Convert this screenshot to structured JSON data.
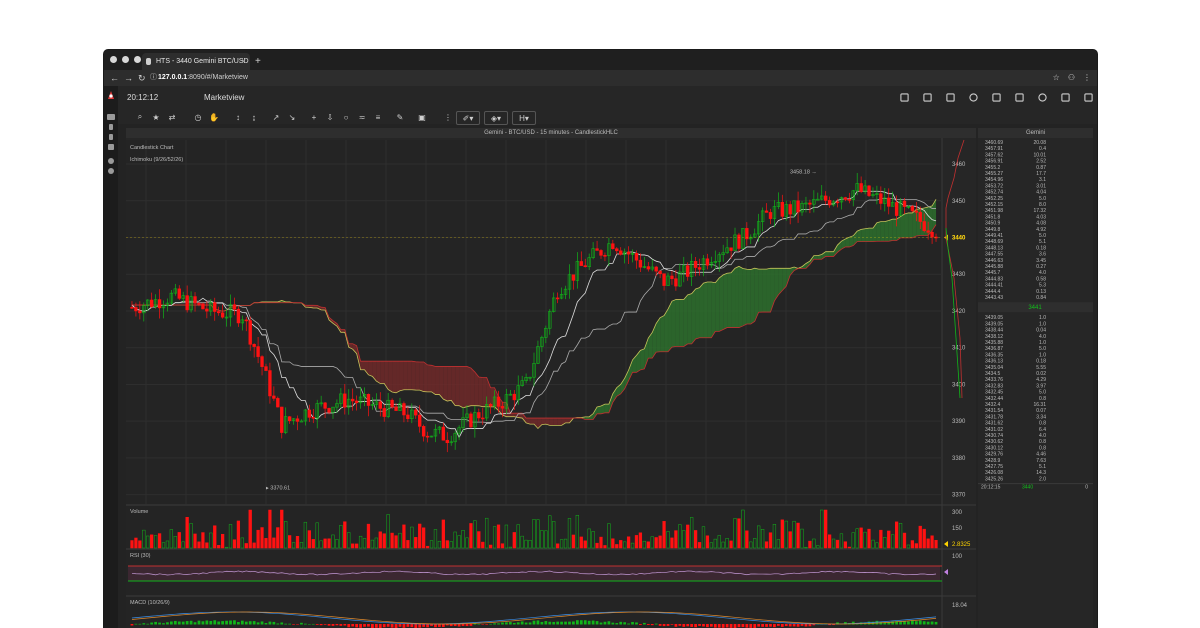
{
  "browser": {
    "tab_title": "HTS - 3440 Gemini BTC/USD",
    "tab_close": "×",
    "new_tab": "+",
    "url_host": "127.0.0.1",
    "url_rest": ":8090/#/Marketview"
  },
  "app": {
    "clock": "20:12:12",
    "page_title": "Marketview",
    "header_icons": [
      "map-icon",
      "tag-icon",
      "layout-icon",
      "bell-icon",
      "send-icon",
      "coins-icon",
      "history-icon",
      "inbox-icon",
      "logout-icon"
    ]
  },
  "chart": {
    "header": "Gemini - BTC/USD - 15 minutes - CandlestickHLC",
    "label_main": "Candlestick Chart",
    "label_ichimoku": "Ichimoku (9/26/52/26)",
    "label_volume": "Volume",
    "label_rsi": "RSI (30)",
    "label_macd": "MACD (10/26/9)",
    "high_marker": "3458.18",
    "low_marker": "3370.61",
    "price_ticks": [
      "3460",
      "3450",
      "3440",
      "3430",
      "3420",
      "3410",
      "3400",
      "3390",
      "3380",
      "3370"
    ],
    "current_price": "3440",
    "volume_ticks": [
      "300",
      "150"
    ],
    "volume_current": "2.8325",
    "rsi_ticks": [
      "100"
    ],
    "macd_ticks": [
      "18.04"
    ],
    "colors": {
      "up": "#11b51a",
      "down": "#ff1212",
      "cloud_red": "#7a2a2a",
      "cloud_green": "#2e7a2e",
      "grid": "#333333"
    }
  },
  "orderbook": {
    "title": "Gemini",
    "asks": [
      [
        "3460.69",
        "20.08"
      ],
      [
        "3457.91",
        "0.4"
      ],
      [
        "3457.62",
        "10.01"
      ],
      [
        "3456.91",
        "2.52"
      ],
      [
        "3455.2",
        "0.87"
      ],
      [
        "3455.27",
        "17.7"
      ],
      [
        "3454.96",
        "3.1"
      ],
      [
        "3453.72",
        "3.01"
      ],
      [
        "3452.74",
        "4.04"
      ],
      [
        "3452.25",
        "5.0"
      ],
      [
        "3452.15",
        "8.0"
      ],
      [
        "3451.98",
        "17.32"
      ],
      [
        "3451.8",
        "4.03"
      ],
      [
        "3450.9",
        "4.08"
      ],
      [
        "3449.8",
        "4.92"
      ],
      [
        "3449.41",
        "5.0"
      ],
      [
        "3448.69",
        "5.1"
      ],
      [
        "3448.13",
        "0.18"
      ],
      [
        "3447.55",
        "3.6"
      ],
      [
        "3446.63",
        "3.45"
      ],
      [
        "3445.88",
        "0.27"
      ],
      [
        "3445.7",
        "4.0"
      ],
      [
        "3444.83",
        "0.58"
      ],
      [
        "3444.41",
        "5.3"
      ],
      [
        "3444.4",
        "0.13"
      ],
      [
        "3443.43",
        "0.84"
      ]
    ],
    "mid_price": "3441",
    "bids": [
      [
        "3439.05",
        "1.0"
      ],
      [
        "3439.05",
        "1.0"
      ],
      [
        "3438.44",
        "0.04"
      ],
      [
        "3438.12",
        "4.0"
      ],
      [
        "3435.88",
        "1.0"
      ],
      [
        "3436.87",
        "5.0"
      ],
      [
        "3436.35",
        "1.0"
      ],
      [
        "3436.13",
        "0.18"
      ],
      [
        "3435.04",
        "5.55"
      ],
      [
        "3434.5",
        "0.02"
      ],
      [
        "3433.76",
        "4.29"
      ],
      [
        "3432.83",
        "3.97"
      ],
      [
        "3432.45",
        "5.0"
      ],
      [
        "3432.44",
        "0.8"
      ],
      [
        "3432.4",
        "16.31"
      ],
      [
        "3431.54",
        "0.07"
      ],
      [
        "3431.78",
        "3.34"
      ],
      [
        "3431.62",
        "0.8"
      ],
      [
        "3431.02",
        "6.4"
      ],
      [
        "3430.74",
        "4.0"
      ],
      [
        "3430.62",
        "0.8"
      ],
      [
        "3430.12",
        "0.8"
      ],
      [
        "3429.76",
        "4.46"
      ],
      [
        "3428.9",
        "7.63"
      ],
      [
        "3427.75",
        "5.1"
      ],
      [
        "3426.08",
        "14.3"
      ],
      [
        "3425.26",
        "2.0"
      ]
    ],
    "footer_time": "20:12:15",
    "footer_price": "3440",
    "footer_qty": "0"
  }
}
